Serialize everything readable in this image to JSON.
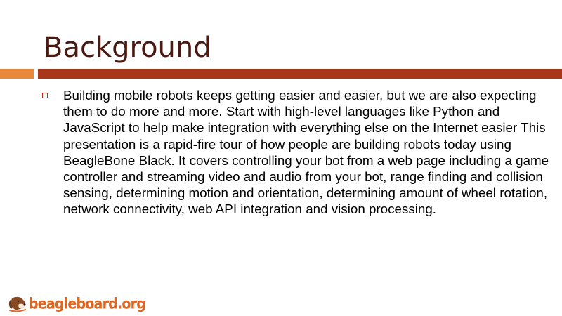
{
  "slide": {
    "title": "Background",
    "bullets": [
      "Building mobile robots keeps getting easier and easier, but we are also expecting them to do more and more. Start with high-level languages like Python and JavaScript to help make integration with everything else on the Internet easier This presentation is a rapid-fire tour of how people are building robots today using BeagleBone Black. It covers controlling your bot from a web page including a game controller and streaming video and audio from your bot, range finding and collision sensing, determining motion and orientation, determining amount of wheel rotation, network connectivity, web API integration and vision processing."
    ]
  },
  "footer": {
    "logo_text": "beagleboard.org",
    "logo_icon": "beagle-dog-icon"
  },
  "colors": {
    "title": "#4a1a12",
    "rule_main": "#a8361a",
    "rule_accent": "#e8883a",
    "logo": "#e0651e",
    "text": "#000000"
  }
}
